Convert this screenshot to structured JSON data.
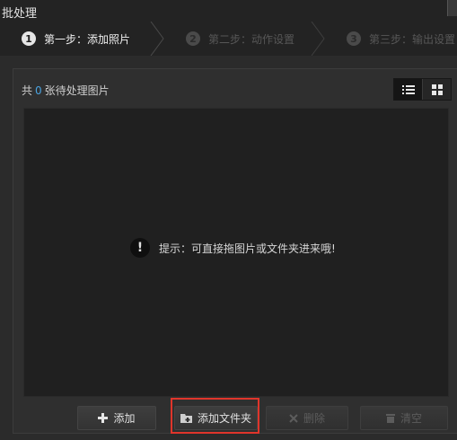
{
  "window": {
    "title": "批处理"
  },
  "steps": [
    {
      "number": "1",
      "label": "第一步：添加照片",
      "state": "active"
    },
    {
      "number": "2",
      "label": "第二步：动作设置",
      "state": "inactive"
    },
    {
      "number": "3",
      "label": "第三步：输出设置",
      "state": "inactive"
    }
  ],
  "image_count": {
    "prefix": "共",
    "value": "0",
    "suffix": "张待处理图片"
  },
  "view_modes": [
    "list-view-icon",
    "grid-view-icon"
  ],
  "hint": {
    "icon": "!",
    "text": "提示：可直接拖图片或文件夹进来哦!"
  },
  "buttons": {
    "add": {
      "icon": "plus-icon",
      "label": "添加"
    },
    "add_folder": {
      "icon": "folder-add-icon",
      "label": "添加文件夹"
    },
    "delete": {
      "icon": "x-icon",
      "label": "删除"
    },
    "clear": {
      "icon": "trash-icon",
      "label": "清空"
    }
  },
  "colors": {
    "accent": "#4aa3df",
    "highlight": "#e0352b"
  }
}
